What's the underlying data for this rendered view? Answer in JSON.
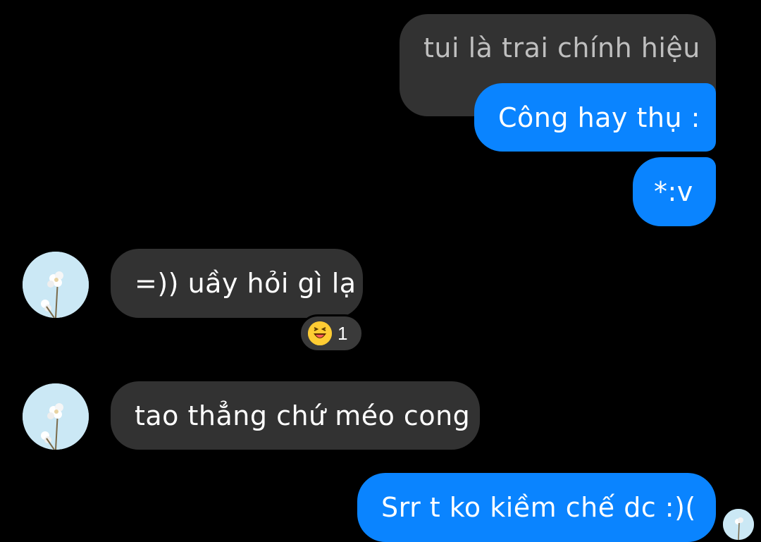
{
  "messages": [
    {
      "text": "tui là trai chính hiệu",
      "sender": "other",
      "style": "quoted"
    },
    {
      "text": "Công hay thụ :",
      "sender": "me"
    },
    {
      "text": "*:v",
      "sender": "me"
    },
    {
      "text": "=)) uầy hỏi gì lạ",
      "sender": "other",
      "reaction": {
        "icon": "laughing-emoji-icon",
        "count": "1"
      }
    },
    {
      "text": "tao thẳng chứ méo cong",
      "sender": "other"
    },
    {
      "text": "Srr t ko kiềm chế dc :)(",
      "sender": "me"
    }
  ],
  "colors": {
    "background": "#000000",
    "sent_bubble": "#0a84ff",
    "received_bubble": "#323232",
    "quoted_text": "#bfbfbf",
    "avatar_bg": "#cbe8f5"
  },
  "avatar": {
    "icon": "flower-avatar-icon"
  }
}
